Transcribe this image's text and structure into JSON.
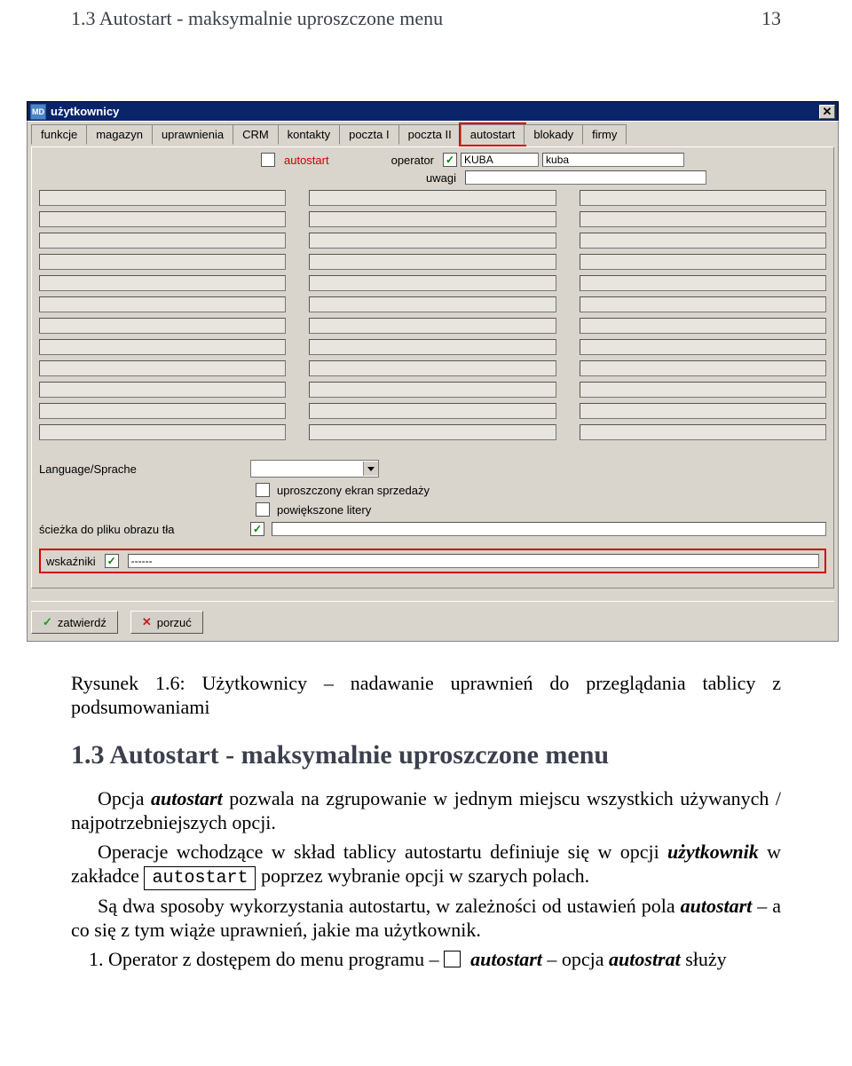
{
  "page_header": {
    "left": "1.3 Autostart - maksymalnie uproszczone menu",
    "right": "13"
  },
  "window": {
    "title": "użytkownicy",
    "close": "✕",
    "tabs": [
      "funkcje",
      "magazyn",
      "uprawnienia",
      "CRM",
      "kontakty",
      "poczta I",
      "poczta II",
      "autostart",
      "blokady",
      "firmy"
    ],
    "active_tab_index": 7,
    "operator_label": "operator",
    "operator_code": "KUBA",
    "operator_name": "kuba",
    "uwagi_label": "uwagi",
    "autostart_label": "autostart",
    "language_label": "Language/Sprache",
    "opt1": "uproszczony ekran sprzedaży",
    "opt2": "powiększone litery",
    "bgpath_label": "ścieżka do pliku obrazu tła",
    "wskazniki_label": "wskaźniki",
    "wskazniki_value": "------",
    "btn_ok": "zatwierdź",
    "btn_cancel": "porzuć",
    "checkmark": "✓"
  },
  "article": {
    "caption": "Rysunek 1.6: Użytkownicy – nadawanie uprawnień do przeglądania tablicy z podsumowaniami",
    "heading": "1.3   Autostart - maksymalnie uproszczone menu",
    "p1a": "Opcja ",
    "p1b": "autostart",
    "p1c": " pozwala na zgrupowanie w jednym miejscu wszystkich używanych / najpotrzebniejszych opcji.",
    "p2a": "Operacje wchodzące w skład tablicy autostartu definiuje się w opcji ",
    "p2b": "użytkownik",
    "p2c": " w zakładce ",
    "p2box": "autostart",
    "p2d": " poprzez wybranie opcji w szarych polach.",
    "p3a": "Są dwa sposoby wykorzystania autostartu, w zależności od ustawień pola ",
    "p3b": "autostart",
    "p3c": " – a co się z tym wiąże uprawnień, jakie ma użytkownik.",
    "list1a": "1. Operator z dostępem do menu programu – ",
    "list1b": "autostart",
    "list1c": " – opcja ",
    "list1d": "autostrat",
    "list1e": " służy"
  }
}
